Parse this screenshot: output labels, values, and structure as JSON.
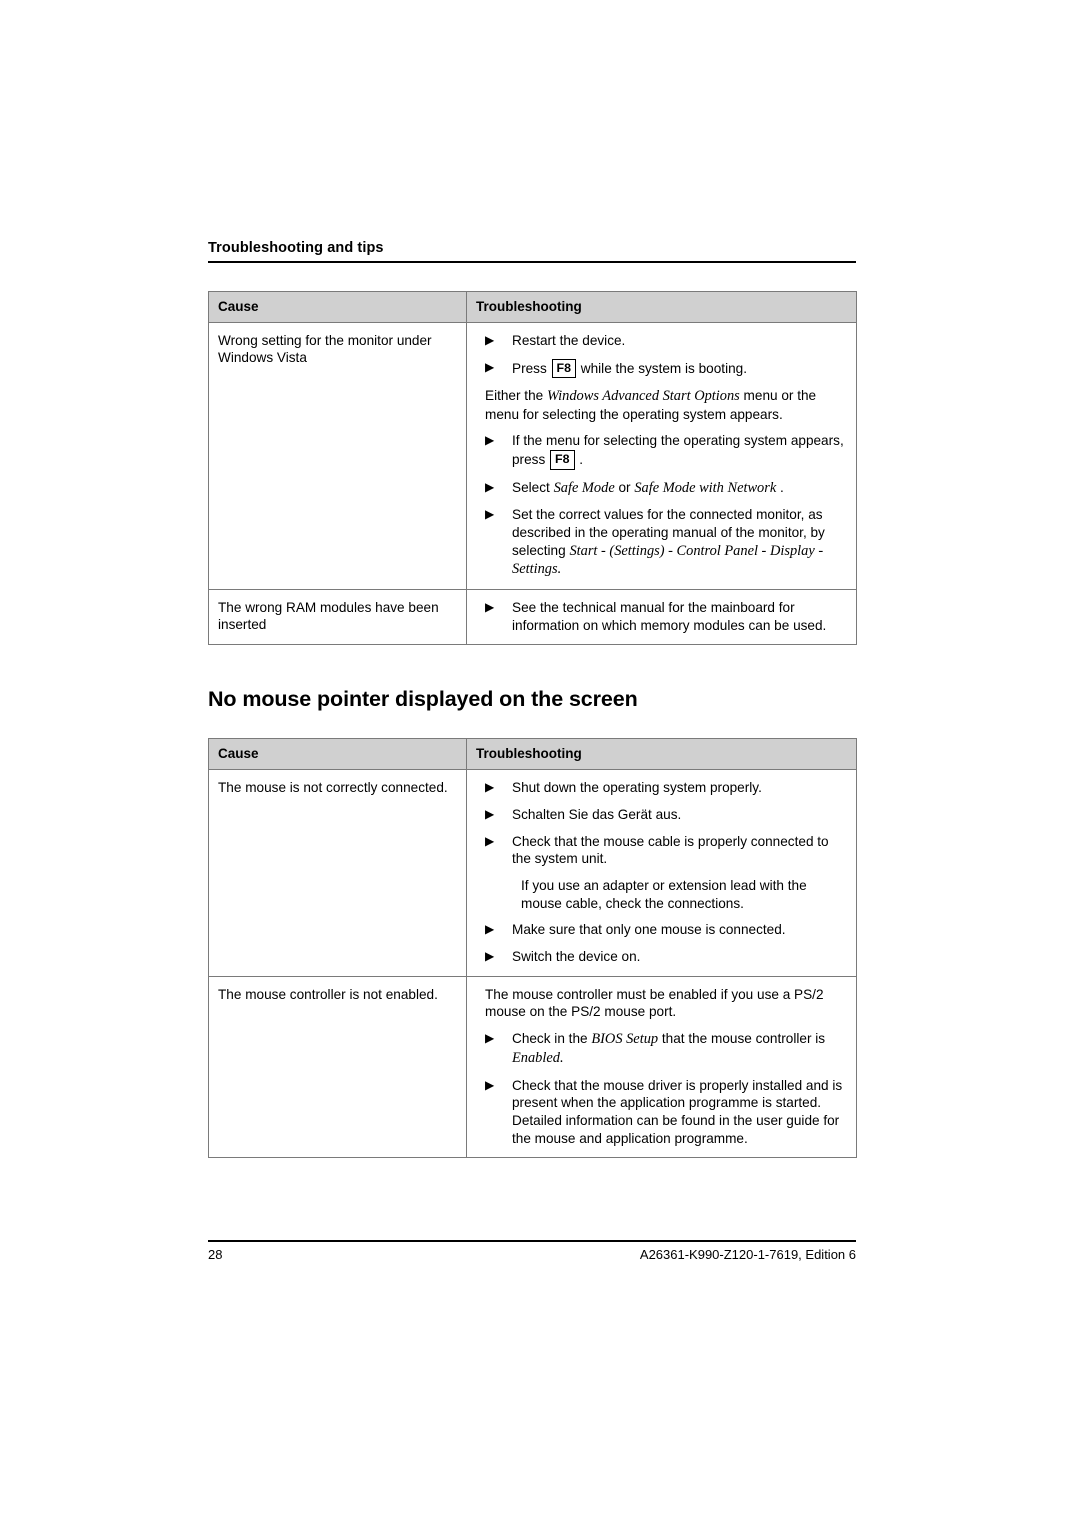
{
  "header": {
    "running_title": "Troubleshooting and tips"
  },
  "tables": [
    {
      "columns": [
        "Cause",
        "Troubleshooting"
      ],
      "rows": [
        {
          "cause": "Wrong setting for the monitor under Windows Vista",
          "steps": [
            {
              "bullet": true,
              "text": "Restart the device."
            },
            {
              "bullet": true,
              "text": "Press ",
              "key": "F8",
              "text_after": " while the system is booting."
            },
            {
              "bullet": false,
              "text": "Either the ",
              "em": "Windows Advanced Start Options",
              "text_after": " menu or the menu for selecting the operating system appears."
            },
            {
              "bullet": true,
              "text": "If the menu for selecting the operating system appears, press ",
              "key": "F8",
              "text_after": " ."
            },
            {
              "bullet": true,
              "text": "Select ",
              "em": "Safe Mode",
              "mid": " or ",
              "em2": "Safe Mode with Network",
              "text_after": " ."
            },
            {
              "bullet": true,
              "text": "Set the correct values for the connected monitor, as described in the operating manual of the monitor, by selecting ",
              "em": "Start - (Settings) - Control Panel - Display - Settings."
            }
          ]
        },
        {
          "cause": "The wrong RAM modules have been inserted",
          "steps": [
            {
              "bullet": true,
              "text": "See the technical manual for the mainboard for information on which memory modules can be used."
            }
          ]
        }
      ]
    },
    {
      "columns": [
        "Cause",
        "Troubleshooting"
      ],
      "rows": [
        {
          "cause": "The mouse is not correctly connected.",
          "steps": [
            {
              "bullet": true,
              "text": "Shut down the operating system properly."
            },
            {
              "bullet": true,
              "text": "Schalten Sie das Gerät aus."
            },
            {
              "bullet": true,
              "text": "Check that the mouse cable is properly connected to the system unit."
            },
            {
              "bullet": false,
              "text": "If you use an adapter or extension lead with the mouse cable, check the connections."
            },
            {
              "bullet": true,
              "text": "Make sure that only one mouse is connected."
            },
            {
              "bullet": true,
              "text": "Switch the device on."
            }
          ]
        },
        {
          "cause": "The mouse controller is not enabled.",
          "steps": [
            {
              "bullet": false,
              "text": "The mouse controller must be enabled if you use a PS/2 mouse on the PS/2 mouse port."
            },
            {
              "bullet": true,
              "text": "Check in the ",
              "em": "BIOS Setup",
              "mid": " that the mouse controller is ",
              "em2": "Enabled."
            },
            {
              "bullet": true,
              "text": "Check that the mouse driver is properly installed and is present when the application programme is started. Detailed information can be found in the user guide for the mouse and application programme."
            }
          ]
        }
      ]
    }
  ],
  "section_heading": "No mouse pointer displayed on the screen",
  "footer": {
    "page_number": "28",
    "doc_id": "A26361-K990-Z120-1-7619, Edition 6"
  },
  "glyphs": {
    "bullet_triangle": "▶"
  },
  "colors": {
    "header_fill": "#d0d0d0",
    "border": "#7a7a7a",
    "text": "#000000"
  }
}
